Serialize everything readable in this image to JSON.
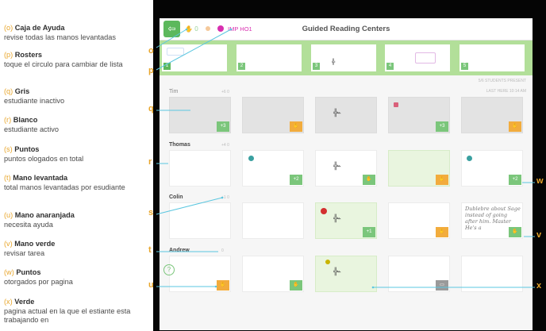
{
  "app": {
    "title": "Guided Reading Centers",
    "hand_count": "0",
    "roster_name": "IMP HO1",
    "students_present": "5/6 STUDENTS PRESENT",
    "last_here": "LAST HERE 10:14 AM",
    "exit_icon": "exit-icon",
    "help_icon": "help-icon"
  },
  "pages": [
    "1",
    "2",
    "3",
    "4",
    "5"
  ],
  "students": [
    {
      "name": "Tim",
      "stats": "+6  0"
    },
    {
      "name": "Thomas",
      "stats": "+4  0"
    },
    {
      "name": "Colin",
      "stats": "+1  0"
    },
    {
      "name": "Andrew",
      "stats": "0"
    }
  ],
  "badges": {
    "plus3": "+3",
    "plus2": "+2",
    "plus1": "+1"
  },
  "handwriting": "Dublebre about Sage instead of going after him. Master He's a",
  "legend": [
    {
      "letter": "(o)",
      "title": "Caja de Ayuda",
      "desc": "revise todas las manos levantadas"
    },
    {
      "letter": "(p)",
      "title": "Rosters",
      "desc": "toque el circulo para cambiar de lista"
    },
    {
      "letter": "(q)",
      "title": "Gris",
      "desc": "estudiante inactivo"
    },
    {
      "letter": "(r)",
      "title": "Blanco",
      "desc": "estudiante activo"
    },
    {
      "letter": "(s)",
      "title": "Puntos",
      "desc": "puntos ologados en total"
    },
    {
      "letter": "(t)",
      "title": "Mano levantada",
      "desc": "total manos levantadas por esudiante"
    },
    {
      "letter": "(u)",
      "title": "Mano anaranjada",
      "desc": "necesita ayuda"
    },
    {
      "letter": "(v)",
      "title": "Mano verde",
      "desc": "revisar tarea"
    },
    {
      "letter": "(w)",
      "title": "Puntos",
      "desc": "otorgados por pagina"
    },
    {
      "letter": "(x)",
      "title": "Verde",
      "desc": "pagina actual en la que el estiante esta trabajando en"
    }
  ],
  "markers": {
    "o": "o",
    "p": "p",
    "q": "q",
    "r": "r",
    "s": "s",
    "t": "t",
    "u": "u",
    "v": "v",
    "w": "w",
    "x": "x"
  },
  "colors": {
    "accent": "#e8a62c",
    "green": "#7bc67b",
    "orange": "#f2ac3d",
    "pink": "#d82fb0",
    "callout": "#5bc7e0"
  }
}
